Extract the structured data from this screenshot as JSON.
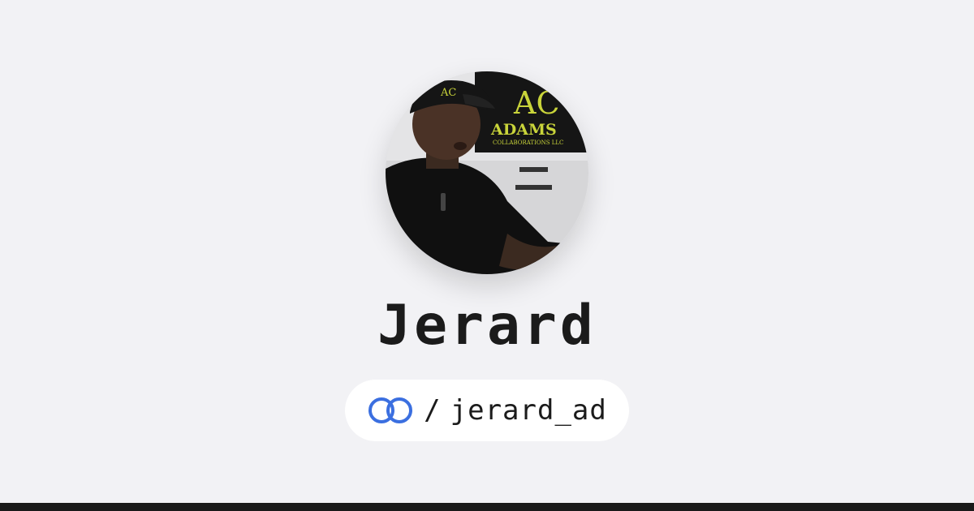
{
  "profile": {
    "name": "Jerard",
    "separator": "/",
    "handle": "jerard_ad",
    "avatar_sign_text": "ADAMS",
    "avatar_sign_sub": "COLLABORATIONS LLC",
    "avatar_sign_logo": "AC"
  },
  "colors": {
    "background": "#f2f2f5",
    "logo_blue": "#3b6fe0",
    "text": "#1b1b1b"
  },
  "icons": {
    "brand_logo": "interlocking-rings-icon"
  }
}
